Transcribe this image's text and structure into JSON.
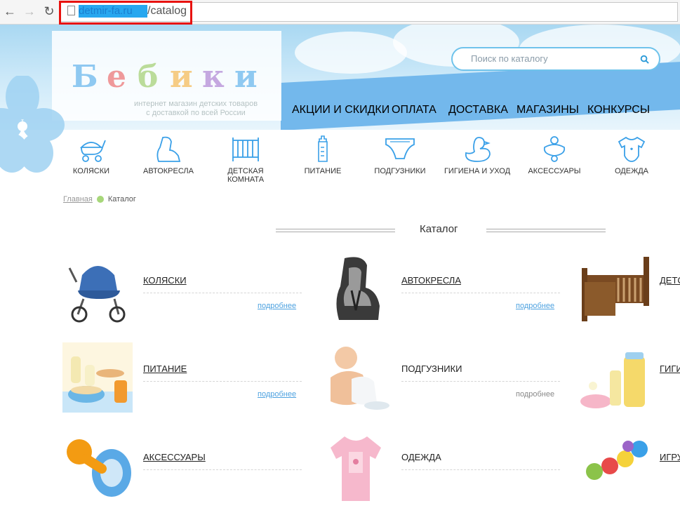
{
  "browser": {
    "back_icon": "arrow-left-icon",
    "forward_icon": "arrow-right-icon",
    "reload_icon": "reload-icon",
    "url_domain": "detmir-fa.ru",
    "url_path": "/catalog"
  },
  "header": {
    "logo_sub_line1": "интернет магазин детских товаров",
    "logo_sub_line2": "с доставкой по всей России",
    "search_placeholder": "Поиск по каталогу"
  },
  "topnav": [
    "АКЦИИ И СКИДКИ",
    "ОПЛАТА",
    "ДОСТАВКА",
    "МАГАЗИНЫ",
    "КОНКУРСЫ"
  ],
  "categories": [
    {
      "label": "КОЛЯСКИ",
      "icon": "stroller-icon"
    },
    {
      "label": "АВТОКРЕСЛА",
      "icon": "car-seat-icon"
    },
    {
      "label": "ДЕТСКАЯ КОМНАТА",
      "icon": "crib-icon"
    },
    {
      "label": "ПИТАНИЕ",
      "icon": "baby-bottle-icon"
    },
    {
      "label": "ПОДГУЗНИКИ",
      "icon": "diaper-icon"
    },
    {
      "label": "ГИГИЕНА И УХОД",
      "icon": "duck-icon"
    },
    {
      "label": "АКСЕССУАРЫ",
      "icon": "pacifier-icon"
    },
    {
      "label": "ОДЕЖДА",
      "icon": "bodysuit-icon"
    }
  ],
  "breadcrumb": {
    "home": "Главная",
    "current": "Каталог"
  },
  "section_title": "Каталог",
  "products": [
    {
      "name": "КОЛЯСКИ",
      "more": "подробнее"
    },
    {
      "name": "АВТОКРЕСЛА",
      "more": "подробнее"
    },
    {
      "name": "ДЕТС"
    },
    {
      "name": "ПИТАНИЕ",
      "more": "подробнее"
    },
    {
      "name": "ПОДГУЗНИКИ",
      "more": "подробнее"
    },
    {
      "name": "ГИГИ"
    },
    {
      "name": "АКСЕССУАРЫ"
    },
    {
      "name": "ОДЕЖДА"
    },
    {
      "name": "ИГРУ"
    }
  ],
  "colors": {
    "accent": "#6fc3eb",
    "nav_band": "#73b8ec",
    "link": "#4ea2e0",
    "url_highlight": "#e8120f"
  }
}
